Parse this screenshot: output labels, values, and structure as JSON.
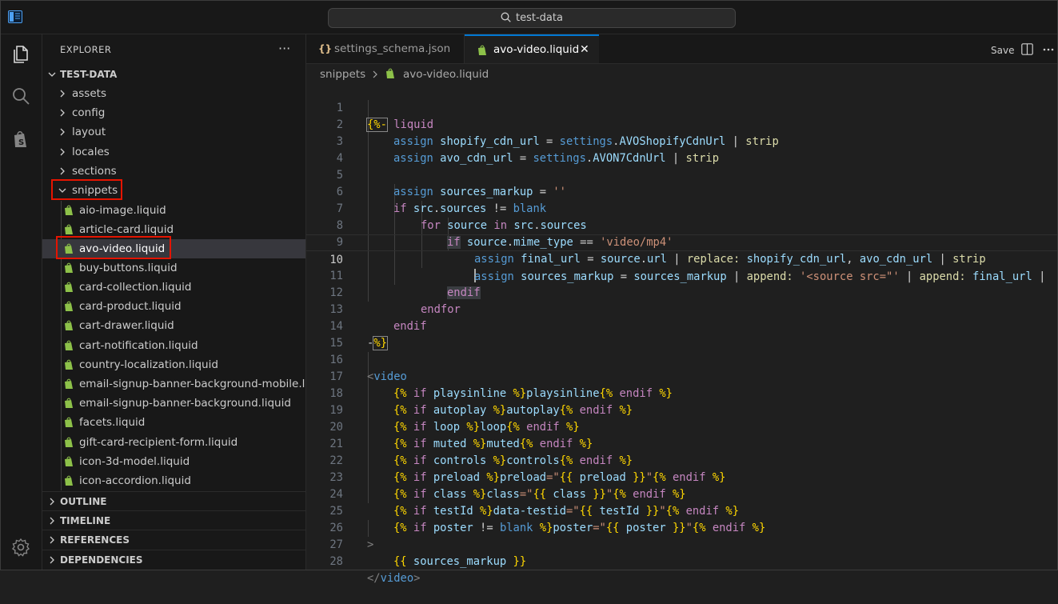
{
  "search": {
    "text": "test-data"
  },
  "explorer": {
    "title": "EXPLORER",
    "more": "···",
    "root": "TEST-DATA",
    "folders": [
      "assets",
      "config",
      "layout",
      "locales",
      "sections"
    ],
    "open_folder": "snippets",
    "files": [
      "aio-image.liquid",
      "article-card.liquid",
      "avo-video.liquid",
      "buy-buttons.liquid",
      "card-collection.liquid",
      "card-product.liquid",
      "cart-drawer.liquid",
      "cart-notification.liquid",
      "country-localization.liquid",
      "email-signup-banner-background-mobile.l...",
      "email-signup-banner-background.liquid",
      "facets.liquid",
      "gift-card-recipient-form.liquid",
      "icon-3d-model.liquid",
      "icon-accordion.liquid"
    ],
    "sections": [
      "OUTLINE",
      "TIMELINE",
      "REFERENCES",
      "DEPENDENCIES"
    ]
  },
  "tabs": [
    {
      "label": "settings_schema.json",
      "icon": "{}"
    },
    {
      "label": "avo-video.liquid",
      "close": "✕"
    }
  ],
  "toolbar": {
    "save": "Save"
  },
  "breadcrumb": {
    "folder": "snippets",
    "file": "avo-video.liquid"
  },
  "editor": {
    "line_numbers": [
      "1",
      "2",
      "3",
      "4",
      "5",
      "6",
      "7",
      "8",
      "9",
      "10",
      "11",
      "12",
      "13",
      "14",
      "15",
      "16",
      "17",
      "18",
      "19",
      "20",
      "21",
      "22",
      "23",
      "24",
      "25",
      "26",
      "27",
      "28"
    ],
    "current_line": "10",
    "code": {
      "l1": [
        "{%-",
        " liquid"
      ],
      "l2": [
        "assign",
        " shopify_cdn_url",
        " = ",
        "settings",
        ".",
        "AVOShopifyCdnUrl",
        " | ",
        "strip"
      ],
      "l3": [
        "assign",
        " avo_cdn_url",
        " = ",
        "settings",
        ".",
        "AVON7CdnUrl",
        " | ",
        "strip"
      ],
      "l5": [
        "assign",
        " sources_markup",
        " = ",
        "''"
      ],
      "l6": [
        "if",
        " src",
        ".",
        "sources",
        " != ",
        "blank"
      ],
      "l7": [
        "for",
        " source",
        " in ",
        "src",
        ".",
        "sources"
      ],
      "l8": [
        "if",
        " source",
        ".",
        "mime_type",
        " == ",
        "'video/mp4'"
      ],
      "l9": [
        "assign",
        " final_url",
        " = ",
        "source",
        ".",
        "url",
        " | ",
        "replace:",
        " shopify_cdn_url",
        ", ",
        "avo_cdn_url",
        " | ",
        "strip"
      ],
      "l10": [
        "assign",
        " sources_markup",
        " = ",
        "sources_markup",
        " | ",
        "append:",
        " '<source src=\"'",
        " | ",
        "append:",
        " final_url",
        " |"
      ],
      "l11": [
        "endif"
      ],
      "l12": [
        "endfor"
      ],
      "l13": [
        "endif"
      ],
      "l14": [
        "-",
        "%}"
      ],
      "l16": [
        "<",
        "video"
      ],
      "l17": [
        "{%",
        " if ",
        "playsinline",
        " %}",
        "playsinline",
        "{%",
        " endif ",
        "%}"
      ],
      "l18": [
        "{%",
        " if ",
        "autoplay",
        " %}",
        "autoplay",
        "{%",
        " endif ",
        "%}"
      ],
      "l19": [
        "{%",
        " if ",
        "loop",
        " %}",
        "loop",
        "{%",
        " endif ",
        "%}"
      ],
      "l20": [
        "{%",
        " if ",
        "muted",
        " %}",
        "muted",
        "{%",
        " endif ",
        "%}"
      ],
      "l21": [
        "{%",
        " if ",
        "controls",
        " %}",
        "controls",
        "{%",
        " endif ",
        "%}"
      ],
      "l22": [
        "{%",
        " if ",
        "preload",
        " %}",
        "preload",
        "=\"",
        "{{",
        " preload ",
        "}}",
        "\"",
        "{%",
        " endif ",
        "%}"
      ],
      "l23": [
        "{%",
        " if ",
        "class",
        " %}",
        "class",
        "=\"",
        "{{",
        " class ",
        "}}",
        "\"",
        "{%",
        " endif ",
        "%}"
      ],
      "l24": [
        "{%",
        " if ",
        "testId",
        " %}",
        "data-testid",
        "=\"",
        "{{",
        " testId ",
        "}}",
        "\"",
        "{%",
        " endif ",
        "%}"
      ],
      "l25": [
        "{%",
        " if ",
        "poster",
        " != ",
        "blank",
        " %}",
        "poster",
        "=\"",
        "{{",
        " poster ",
        "}}",
        "\"",
        "{%",
        " endif ",
        "%}"
      ],
      "l26": [
        ">"
      ],
      "l27": [
        "{{",
        " sources_markup ",
        "}}"
      ],
      "l28": [
        "</",
        "video",
        ">"
      ]
    }
  }
}
